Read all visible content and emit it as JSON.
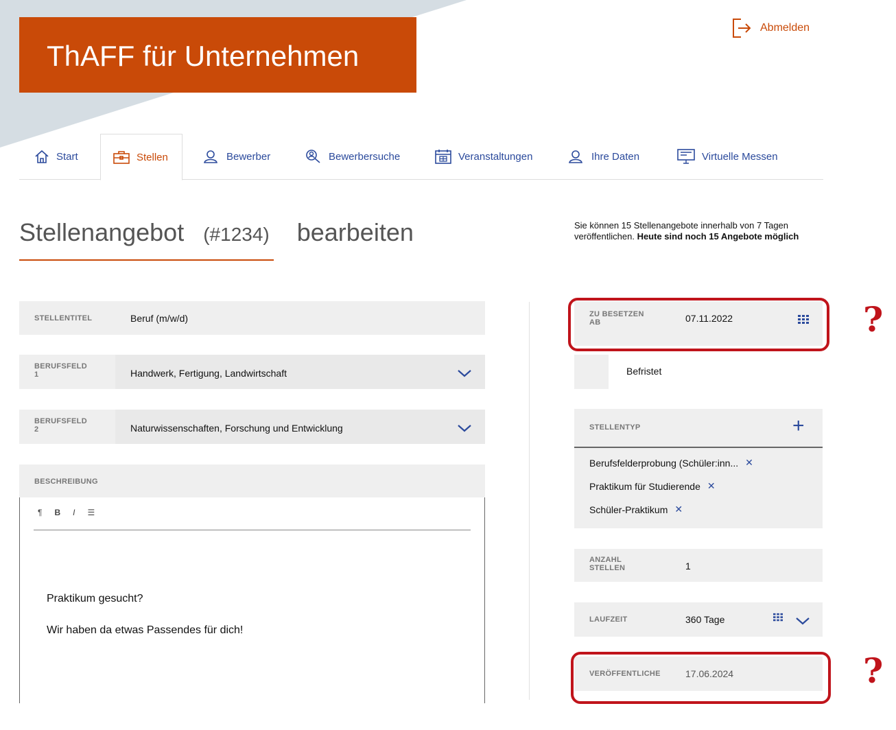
{
  "brand": {
    "title": "ThAFF für Unternehmen",
    "color": "#c94a08"
  },
  "header": {
    "logout_label": "Abmelden",
    "logout_icon": "logout-icon"
  },
  "nav": {
    "tabs": [
      {
        "label": "Start",
        "icon": "home-icon"
      },
      {
        "label": "Stellen",
        "icon": "briefcase-icon",
        "active": true
      },
      {
        "label": "Bewerber",
        "icon": "user-icon"
      },
      {
        "label": "Bewerbersuche",
        "icon": "user-search-icon"
      },
      {
        "label": "Veranstaltungen",
        "icon": "calendar-icon"
      },
      {
        "label": "Ihre Daten",
        "icon": "user-icon"
      },
      {
        "label": "Virtuelle Messen",
        "icon": "monitor-icon"
      }
    ]
  },
  "page": {
    "title_main": "Stellenangebot",
    "title_id": "(#1234)",
    "title_action": "bearbeiten"
  },
  "info": {
    "text_plain": "Sie können 15 Stellenangebote innerhalb von 7 Tagen veröffentlichen.",
    "text_bold": "Heute sind noch 15 Angebote möglich"
  },
  "form": {
    "stellentitel": {
      "label": "STELLENTITEL",
      "value": "Beruf (m/w/d)"
    },
    "berufsfeld1": {
      "label_line1": "BERUFSFELD",
      "label_line2": "1",
      "value": "Handwerk, Fertigung, Landwirtschaft"
    },
    "berufsfeld2": {
      "label_line1": "BERUFSFELD",
      "label_line2": "2",
      "value": "Naturwissenschaften, Forschung und Entwicklung"
    },
    "beschreibung": {
      "label": "BESCHREIBUNG",
      "toolbar": {
        "paragraph": "¶",
        "bold": "B",
        "italic": "I",
        "list": "☰"
      },
      "paragraph1": "Praktikum gesucht?",
      "paragraph2": "Wir haben da etwas Passendes für dich!"
    },
    "zu_besetzen": {
      "label_line1": "ZU BESETZEN",
      "label_line2": "AB",
      "value": "07.11.2022"
    },
    "befristet": {
      "label": "Befristet"
    },
    "stellentyp": {
      "label": "STELLENTYP",
      "add": "+",
      "items": [
        "Berufsfelderprobung (Schüler:inn...",
        "Praktikum für Studierende",
        "Schüler-Praktikum"
      ],
      "remove": "✕"
    },
    "anzahl": {
      "label_line1": "ANZAHL",
      "label_line2": "STELLEN",
      "value": "1"
    },
    "laufzeit": {
      "label": "LAUFZEIT",
      "value": "360 Tage"
    },
    "veroeffentlichen": {
      "label": "VERÖFFENTLICHE",
      "value": "17.06.2024"
    }
  },
  "annotations": {
    "question": "?",
    "color": "#c0141b"
  }
}
